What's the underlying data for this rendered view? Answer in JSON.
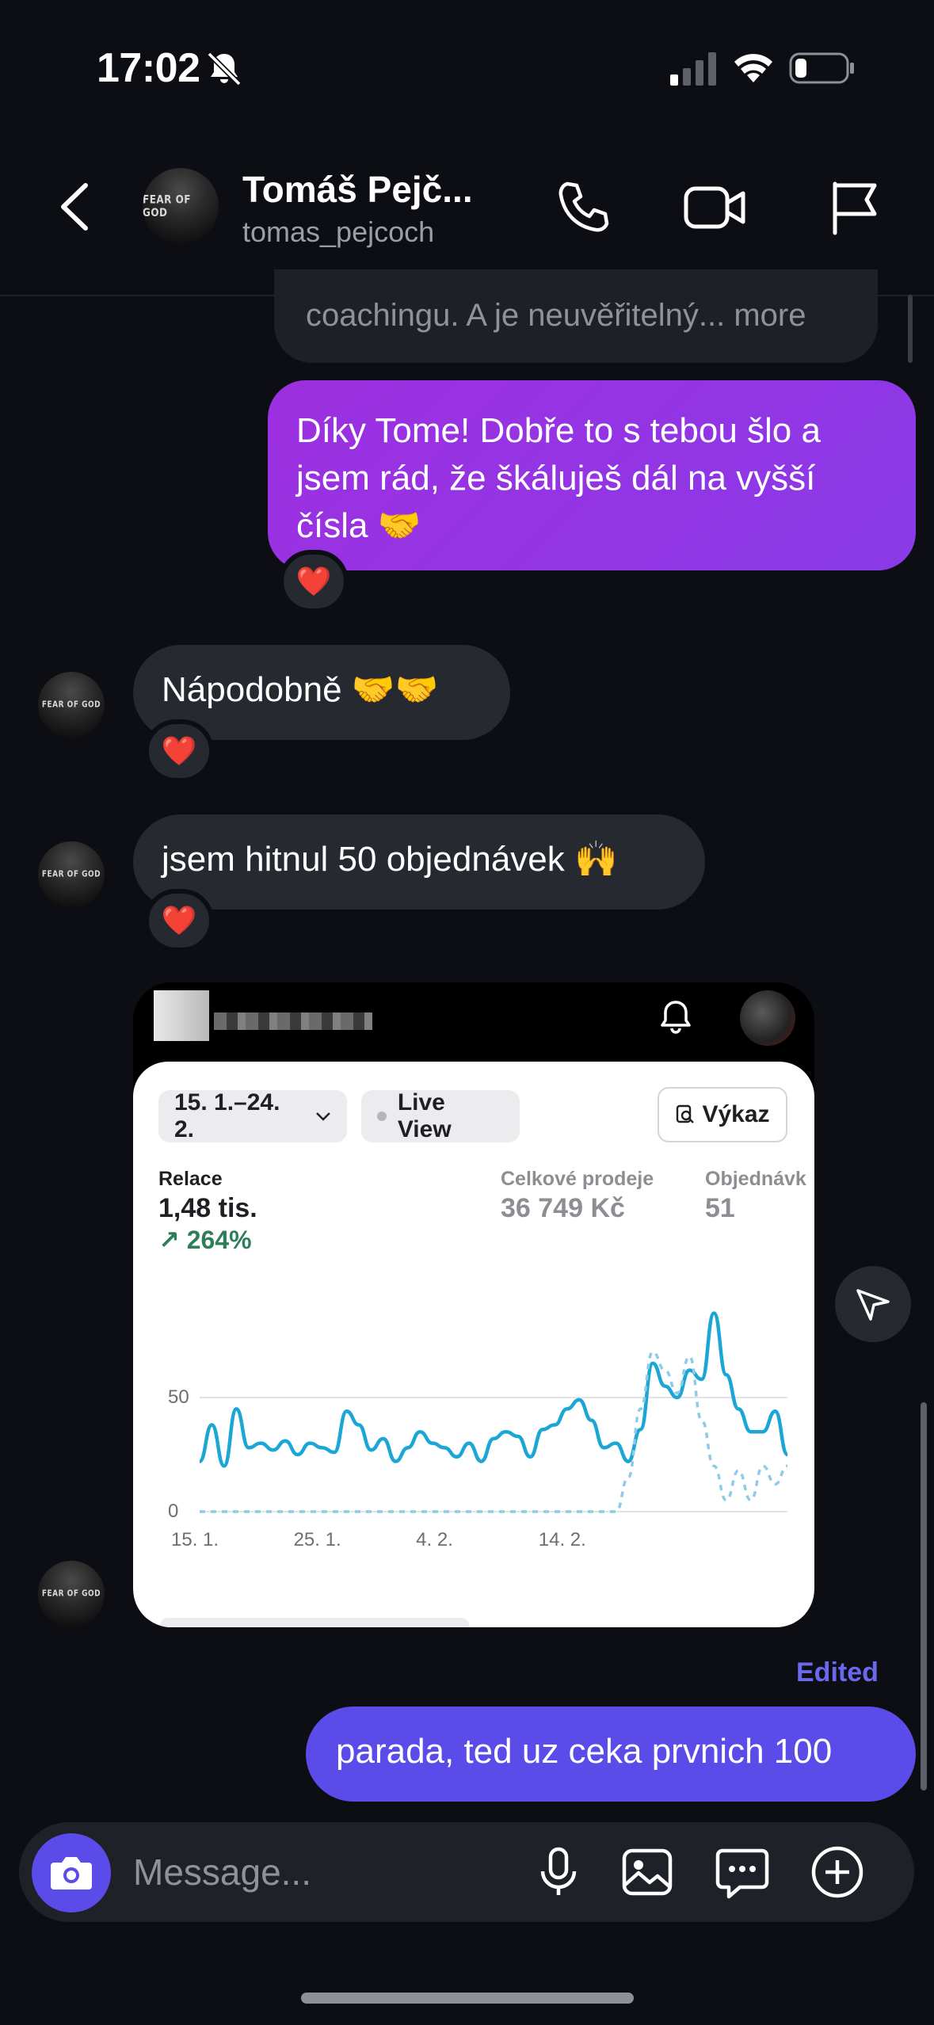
{
  "status_bar": {
    "time": "17:02",
    "battery_level": 0.2
  },
  "header": {
    "contact_name": "Tomáš Pejč...",
    "username": "tomas_pejcoch",
    "avatar_text": "FEAR OF GOD"
  },
  "messages": {
    "quoted_tail": "coachingu. A je neuvěřitelný... more",
    "out_1": {
      "line1": "Díky Tome! Dobře to s tebou šlo a",
      "line2": "jsem rád, že škáluješ dál na vyšší",
      "line3": "čísla 🤝",
      "reaction": "❤️"
    },
    "in_1": {
      "text": "Nápodobně 🤝🤝",
      "reaction": "❤️"
    },
    "in_2": {
      "text": "jsem hitnul 50 objednávek 🙌",
      "reaction": "❤️"
    },
    "edited_label": "Edited",
    "out_2": {
      "text": "parada, ted uz ceka prvnich 100"
    }
  },
  "screenshot_card": {
    "date_range": "15. 1.–24. 2.",
    "live_view": "Live View",
    "report_button": "Výkaz",
    "metrics": [
      {
        "label": "Relace",
        "value": "1,48 tis.",
        "delta": "↗ 264%"
      },
      {
        "label": "Celkové prodeje",
        "value": "36 749 Kč"
      },
      {
        "label": "Objednávk",
        "value": "51"
      }
    ]
  },
  "chart_data": {
    "type": "line",
    "x_tick_labels": [
      "15. 1.",
      "25. 1.",
      "4. 2.",
      "14. 2."
    ],
    "y_tick_labels": [
      "0",
      "50"
    ],
    "ylim": [
      0,
      100
    ],
    "series": [
      {
        "style": "solid",
        "color": "#1ba6d6",
        "values": [
          22,
          38,
          20,
          45,
          28,
          30,
          27,
          31,
          25,
          30,
          28,
          26,
          44,
          38,
          27,
          32,
          22,
          28,
          35,
          30,
          28,
          24,
          30,
          22,
          32,
          35,
          33,
          24,
          36,
          38,
          45,
          49,
          40,
          28,
          30,
          22,
          36,
          65,
          55,
          50,
          62,
          58,
          87,
          60,
          45,
          35,
          35,
          44,
          25
        ]
      },
      {
        "style": "dashed",
        "color": "#8ecbe6",
        "values": [
          0,
          0,
          0,
          0,
          0,
          0,
          0,
          0,
          0,
          0,
          0,
          0,
          0,
          0,
          0,
          0,
          0,
          0,
          0,
          0,
          0,
          0,
          0,
          0,
          0,
          0,
          0,
          0,
          0,
          0,
          0,
          0,
          0,
          0,
          0,
          15,
          45,
          70,
          62,
          52,
          68,
          40,
          20,
          5,
          18,
          5,
          20,
          12,
          20
        ]
      }
    ]
  },
  "composer": {
    "placeholder": "Message..."
  },
  "colors": {
    "accent_blue": "#5b4be9",
    "accent_purple": "#9d2fe0",
    "edited": "#6b68f0"
  }
}
